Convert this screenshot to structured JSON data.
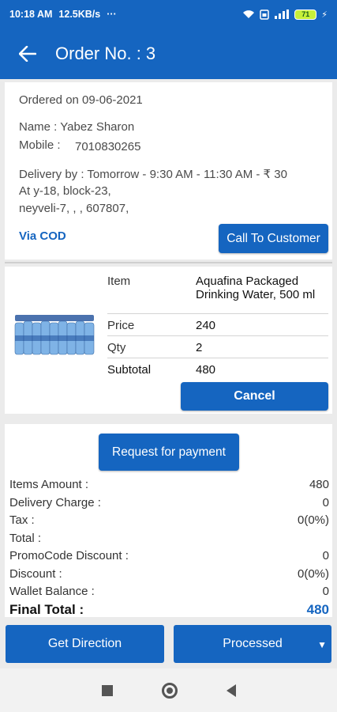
{
  "status_bar": {
    "time": "10:18 AM",
    "speed": "12.5KB/s",
    "dots": "···",
    "battery": "71"
  },
  "app_bar": {
    "title": "Order No. : 3"
  },
  "order": {
    "ordered_on": "Ordered on 09-06-2021",
    "name": "Name : Yabez Sharon",
    "mobile_label": "Mobile :",
    "mobile_value": "7010830265",
    "delivery": "Delivery by : Tomorrow - 9:30 AM - 11:30 AM - ₹ 30",
    "address_line1": "At y-18, block-23,",
    "address_line2": "neyveli-7, , , 607807,",
    "payment_mode": "Via COD",
    "call_button": "Call To Customer"
  },
  "item": {
    "rows": [
      {
        "label": "Item",
        "value": "Aquafina Packaged Drinking Water, 500 ml"
      },
      {
        "label": "Price",
        "value": "240"
      },
      {
        "label": "Qty",
        "value": "2"
      },
      {
        "label": "Subtotal",
        "value": "480"
      }
    ],
    "cancel_button": "Cancel"
  },
  "summary": {
    "request_button": "Request for payment",
    "rows": [
      {
        "label": "Items Amount :",
        "value": "480"
      },
      {
        "label": "Delivery Charge :",
        "value": "0"
      },
      {
        "label": "Tax :",
        "value": "0(0%)"
      },
      {
        "label": "Total :",
        "value": ""
      },
      {
        "label": "PromoCode Discount :",
        "value": "0"
      },
      {
        "label": "Discount :",
        "value": "0(0%)"
      },
      {
        "label": "Wallet Balance :",
        "value": "0"
      }
    ],
    "final_label": "Final Total :",
    "final_value": "480"
  },
  "bottom": {
    "direction_button": "Get Direction",
    "status_button": "Processed"
  },
  "colors": {
    "primary": "#1565c0"
  }
}
